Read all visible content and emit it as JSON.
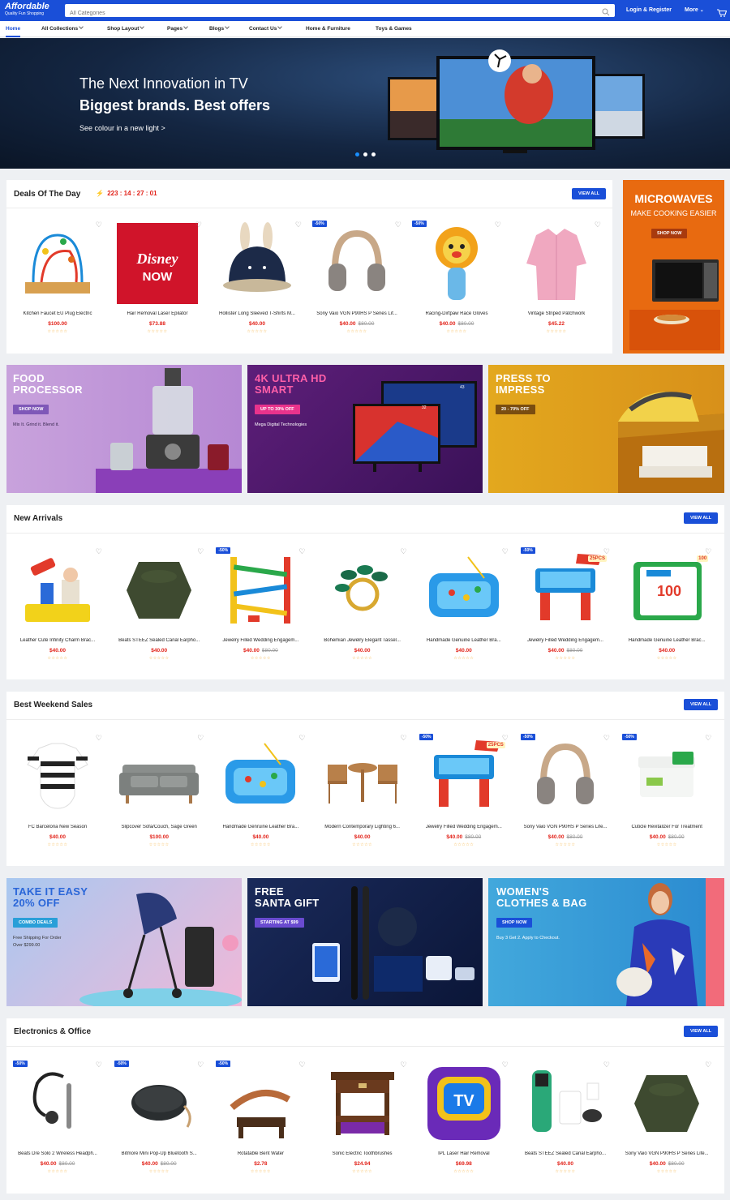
{
  "header": {
    "logo_title": "Affordable",
    "logo_tagline": "Quality Fun Shopping",
    "search_placeholder": "All Categories",
    "login_label": "Login & Register",
    "more_label": "More"
  },
  "nav": [
    {
      "label": "Home",
      "active": true
    },
    {
      "label": "All Collections",
      "caret": true
    },
    {
      "label": "Shop Layout",
      "caret": true
    },
    {
      "label": "Pages",
      "caret": true
    },
    {
      "label": "Blogs",
      "caret": true
    },
    {
      "label": "Contact Us",
      "caret": true
    },
    {
      "label": "Home & Furniture"
    },
    {
      "label": "Toys & Games"
    }
  ],
  "hero": {
    "line1": "The Next Innovation in TV",
    "line2": "Biggest brands. Best offers",
    "link": "See colour in a new light >",
    "slides": 3,
    "active_slide": 1
  },
  "deals": {
    "title": "Deals Of The Day",
    "countdown": "223 : 14 : 27 : 01",
    "view_all": "VIEW ALL",
    "products": [
      {
        "name": "Kitchen Faucet EU Plug Electric",
        "price": "$100.00",
        "icon": "bead-maze-icon"
      },
      {
        "name": "Hair Removal Laser Epilator",
        "price": "$73.88",
        "icon": "disney-now-icon"
      },
      {
        "name": "Hollister Long Sleeved T-Shirts M...",
        "price": "$40.00",
        "icon": "bunny-hat-icon"
      },
      {
        "name": "Sony Vaio VGN P90HS P Series Lif...",
        "price": "$40.00",
        "old_price": "$80.00",
        "badge": "-50%",
        "icon": "headphones-icon"
      },
      {
        "name": "Racing-Dirtpaw Race Gloves",
        "price": "$40.00",
        "old_price": "$80.00",
        "badge": "-50%",
        "icon": "lion-toy-icon"
      },
      {
        "name": "Vintage Striped Patchwork",
        "price": "$45.22",
        "icon": "pink-shirt-icon"
      }
    ]
  },
  "side_banner": {
    "title": "MICROWAVES",
    "subtitle": "MAKE COOKING EASIER",
    "button": "SHOP NOW"
  },
  "promo1": [
    {
      "title1": "FOOD",
      "title2": "PROCESSOR",
      "button": "SHOP NOW",
      "text": "Mix It. Grind it. Blend it."
    },
    {
      "title1": "4K ULTRA HD",
      "title2": "SMART",
      "button": "UP TO 30% OFF",
      "text": "Mega Digital Technologies",
      "screen_labels": [
        "32",
        "43"
      ]
    },
    {
      "title1": "PRESS TO",
      "title2": "IMPRESS",
      "button": "20 - 70% OFF"
    }
  ],
  "new_arrivals": {
    "title": "New Arrivals",
    "view_all": "VIEW ALL",
    "products": [
      {
        "name": "Leather Cute Infinity Charm Brac...",
        "price": "$40.00",
        "icon": "hammer-toy-icon"
      },
      {
        "name": "Beats STEEZ Sealed Canal Earpho...",
        "price": "$40.00",
        "icon": "speaker-icon"
      },
      {
        "name": "Jewelry Filled Wedding Engagem...",
        "price": "$40.00",
        "old_price": "$80.00",
        "badge": "-50%",
        "icon": "car-ramp-icon"
      },
      {
        "name": "Bohemian Jewelry Elegant Tassel...",
        "price": "$40.00",
        "icon": "ring-icon"
      },
      {
        "name": "Handmade Genuine Leather Bra...",
        "price": "$40.00",
        "icon": "fishing-pool-icon"
      },
      {
        "name": "Jewelry Filled Wedding Engagem...",
        "price": "$40.00",
        "old_price": "$80.00",
        "badge": "-50%",
        "badge_text": "25PCS",
        "icon": "water-table-icon"
      },
      {
        "name": "Handmade Genuine Leather Brac...",
        "price": "$40.00",
        "badge_text": "100",
        "icon": "book-toy-icon"
      }
    ]
  },
  "weekend": {
    "title": "Best Weekend Sales",
    "view_all": "VIEW ALL",
    "products": [
      {
        "name": "FC Barcelona New Season",
        "price": "$40.00",
        "icon": "onesie-icon"
      },
      {
        "name": "Slipcover Sofa/Couch, Sage Green",
        "price": "$100.00",
        "icon": "sofa-icon"
      },
      {
        "name": "Handmade Genruine Leather Bra...",
        "price": "$40.00",
        "icon": "fishing-pool-icon"
      },
      {
        "name": "Modern Contemporary Lighting 6...",
        "price": "$40.00",
        "icon": "patio-set-icon"
      },
      {
        "name": "Jewelry Filled Wedding Engagem...",
        "price": "$40.00",
        "old_price": "$80.00",
        "badge": "-50%",
        "badge_text": "25PCS",
        "icon": "water-table-icon"
      },
      {
        "name": "Sony Vaio VGN P90HS P Series Life...",
        "price": "$40.00",
        "old_price": "$80.00",
        "badge": "-50%",
        "icon": "headphones-icon"
      },
      {
        "name": "Cuticle Revitalizer For Treatment",
        "price": "$40.00",
        "old_price": "$80.00",
        "badge": "-50%",
        "icon": "cream-jar-icon"
      }
    ]
  },
  "promo2": [
    {
      "title1": "TAKE IT EASY",
      "title2": "20% OFF",
      "button": "COMBO DEALS",
      "text": "Free Shipping For Order",
      "text2": "Over $299.00"
    },
    {
      "title1": "FREE",
      "title2": "SANTA GIFT",
      "button": "STARTING AT $99"
    },
    {
      "title1": "WOMEN'S",
      "title2": "CLOTHES & BAG",
      "button": "SHOP NOW",
      "text": "Buy 3 Get 2. Apply to Checkout."
    }
  ],
  "electronics": {
    "title": "Electronics & Office",
    "view_all": "VIEW ALL",
    "products": [
      {
        "name": "Beats Dre Solo 2 Wireless Headph...",
        "price": "$40.00",
        "old_price": "$80.00",
        "badge": "-50%",
        "icon": "earhook-icon"
      },
      {
        "name": "Bitmore Mini Pop-Up Bluetooth S...",
        "price": "$40.00",
        "old_price": "$80.00",
        "badge": "-50%",
        "icon": "round-speaker-icon"
      },
      {
        "name": "Rotatable Bent Water",
        "price": "$2.78",
        "badge": "-50%",
        "icon": "leather-strap-icon"
      },
      {
        "name": "Sonic Electric Toothbrushes",
        "price": "$24.94",
        "icon": "side-table-icon"
      },
      {
        "name": "IPL Laser Hair Removal",
        "price": "$69.98",
        "icon": "tv-app-icon"
      },
      {
        "name": "Beats STEEZ Sealed Canal Earpho...",
        "price": "$40.00",
        "icon": "epilator-icon"
      },
      {
        "name": "Sony Vaio VGN P90HS P Series Life...",
        "price": "$40.00",
        "old_price": "$80.00",
        "icon": "speaker-icon"
      }
    ]
  },
  "rating_stars": "☆☆☆☆☆",
  "colors": {
    "primary": "#1a4fd8",
    "price": "#e2231a",
    "background": "#eef0f3"
  }
}
